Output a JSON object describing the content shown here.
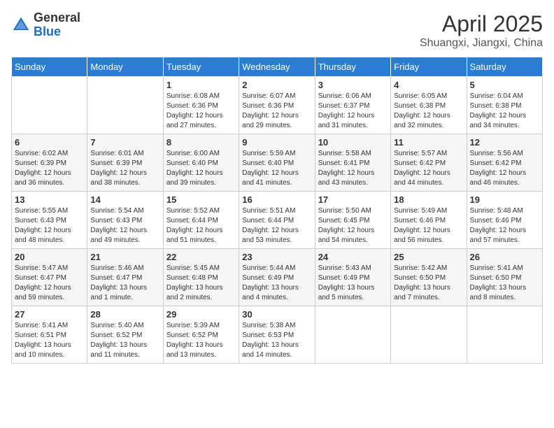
{
  "header": {
    "logo_general": "General",
    "logo_blue": "Blue",
    "title": "April 2025",
    "subtitle": "Shuangxi, Jiangxi, China"
  },
  "weekdays": [
    "Sunday",
    "Monday",
    "Tuesday",
    "Wednesday",
    "Thursday",
    "Friday",
    "Saturday"
  ],
  "weeks": [
    [
      {
        "day": null
      },
      {
        "day": null
      },
      {
        "day": "1",
        "sunrise": "Sunrise: 6:08 AM",
        "sunset": "Sunset: 6:36 PM",
        "daylight": "Daylight: 12 hours and 27 minutes."
      },
      {
        "day": "2",
        "sunrise": "Sunrise: 6:07 AM",
        "sunset": "Sunset: 6:36 PM",
        "daylight": "Daylight: 12 hours and 29 minutes."
      },
      {
        "day": "3",
        "sunrise": "Sunrise: 6:06 AM",
        "sunset": "Sunset: 6:37 PM",
        "daylight": "Daylight: 12 hours and 31 minutes."
      },
      {
        "day": "4",
        "sunrise": "Sunrise: 6:05 AM",
        "sunset": "Sunset: 6:38 PM",
        "daylight": "Daylight: 12 hours and 32 minutes."
      },
      {
        "day": "5",
        "sunrise": "Sunrise: 6:04 AM",
        "sunset": "Sunset: 6:38 PM",
        "daylight": "Daylight: 12 hours and 34 minutes."
      }
    ],
    [
      {
        "day": "6",
        "sunrise": "Sunrise: 6:02 AM",
        "sunset": "Sunset: 6:39 PM",
        "daylight": "Daylight: 12 hours and 36 minutes."
      },
      {
        "day": "7",
        "sunrise": "Sunrise: 6:01 AM",
        "sunset": "Sunset: 6:39 PM",
        "daylight": "Daylight: 12 hours and 38 minutes."
      },
      {
        "day": "8",
        "sunrise": "Sunrise: 6:00 AM",
        "sunset": "Sunset: 6:40 PM",
        "daylight": "Daylight: 12 hours and 39 minutes."
      },
      {
        "day": "9",
        "sunrise": "Sunrise: 5:59 AM",
        "sunset": "Sunset: 6:40 PM",
        "daylight": "Daylight: 12 hours and 41 minutes."
      },
      {
        "day": "10",
        "sunrise": "Sunrise: 5:58 AM",
        "sunset": "Sunset: 6:41 PM",
        "daylight": "Daylight: 12 hours and 43 minutes."
      },
      {
        "day": "11",
        "sunrise": "Sunrise: 5:57 AM",
        "sunset": "Sunset: 6:42 PM",
        "daylight": "Daylight: 12 hours and 44 minutes."
      },
      {
        "day": "12",
        "sunrise": "Sunrise: 5:56 AM",
        "sunset": "Sunset: 6:42 PM",
        "daylight": "Daylight: 12 hours and 46 minutes."
      }
    ],
    [
      {
        "day": "13",
        "sunrise": "Sunrise: 5:55 AM",
        "sunset": "Sunset: 6:43 PM",
        "daylight": "Daylight: 12 hours and 48 minutes."
      },
      {
        "day": "14",
        "sunrise": "Sunrise: 5:54 AM",
        "sunset": "Sunset: 6:43 PM",
        "daylight": "Daylight: 12 hours and 49 minutes."
      },
      {
        "day": "15",
        "sunrise": "Sunrise: 5:52 AM",
        "sunset": "Sunset: 6:44 PM",
        "daylight": "Daylight: 12 hours and 51 minutes."
      },
      {
        "day": "16",
        "sunrise": "Sunrise: 5:51 AM",
        "sunset": "Sunset: 6:44 PM",
        "daylight": "Daylight: 12 hours and 53 minutes."
      },
      {
        "day": "17",
        "sunrise": "Sunrise: 5:50 AM",
        "sunset": "Sunset: 6:45 PM",
        "daylight": "Daylight: 12 hours and 54 minutes."
      },
      {
        "day": "18",
        "sunrise": "Sunrise: 5:49 AM",
        "sunset": "Sunset: 6:46 PM",
        "daylight": "Daylight: 12 hours and 56 minutes."
      },
      {
        "day": "19",
        "sunrise": "Sunrise: 5:48 AM",
        "sunset": "Sunset: 6:46 PM",
        "daylight": "Daylight: 12 hours and 57 minutes."
      }
    ],
    [
      {
        "day": "20",
        "sunrise": "Sunrise: 5:47 AM",
        "sunset": "Sunset: 6:47 PM",
        "daylight": "Daylight: 12 hours and 59 minutes."
      },
      {
        "day": "21",
        "sunrise": "Sunrise: 5:46 AM",
        "sunset": "Sunset: 6:47 PM",
        "daylight": "Daylight: 13 hours and 1 minute."
      },
      {
        "day": "22",
        "sunrise": "Sunrise: 5:45 AM",
        "sunset": "Sunset: 6:48 PM",
        "daylight": "Daylight: 13 hours and 2 minutes."
      },
      {
        "day": "23",
        "sunrise": "Sunrise: 5:44 AM",
        "sunset": "Sunset: 6:49 PM",
        "daylight": "Daylight: 13 hours and 4 minutes."
      },
      {
        "day": "24",
        "sunrise": "Sunrise: 5:43 AM",
        "sunset": "Sunset: 6:49 PM",
        "daylight": "Daylight: 13 hours and 5 minutes."
      },
      {
        "day": "25",
        "sunrise": "Sunrise: 5:42 AM",
        "sunset": "Sunset: 6:50 PM",
        "daylight": "Daylight: 13 hours and 7 minutes."
      },
      {
        "day": "26",
        "sunrise": "Sunrise: 5:41 AM",
        "sunset": "Sunset: 6:50 PM",
        "daylight": "Daylight: 13 hours and 8 minutes."
      }
    ],
    [
      {
        "day": "27",
        "sunrise": "Sunrise: 5:41 AM",
        "sunset": "Sunset: 6:51 PM",
        "daylight": "Daylight: 13 hours and 10 minutes."
      },
      {
        "day": "28",
        "sunrise": "Sunrise: 5:40 AM",
        "sunset": "Sunset: 6:52 PM",
        "daylight": "Daylight: 13 hours and 11 minutes."
      },
      {
        "day": "29",
        "sunrise": "Sunrise: 5:39 AM",
        "sunset": "Sunset: 6:52 PM",
        "daylight": "Daylight: 13 hours and 13 minutes."
      },
      {
        "day": "30",
        "sunrise": "Sunrise: 5:38 AM",
        "sunset": "Sunset: 6:53 PM",
        "daylight": "Daylight: 13 hours and 14 minutes."
      },
      {
        "day": null
      },
      {
        "day": null
      },
      {
        "day": null
      }
    ]
  ]
}
